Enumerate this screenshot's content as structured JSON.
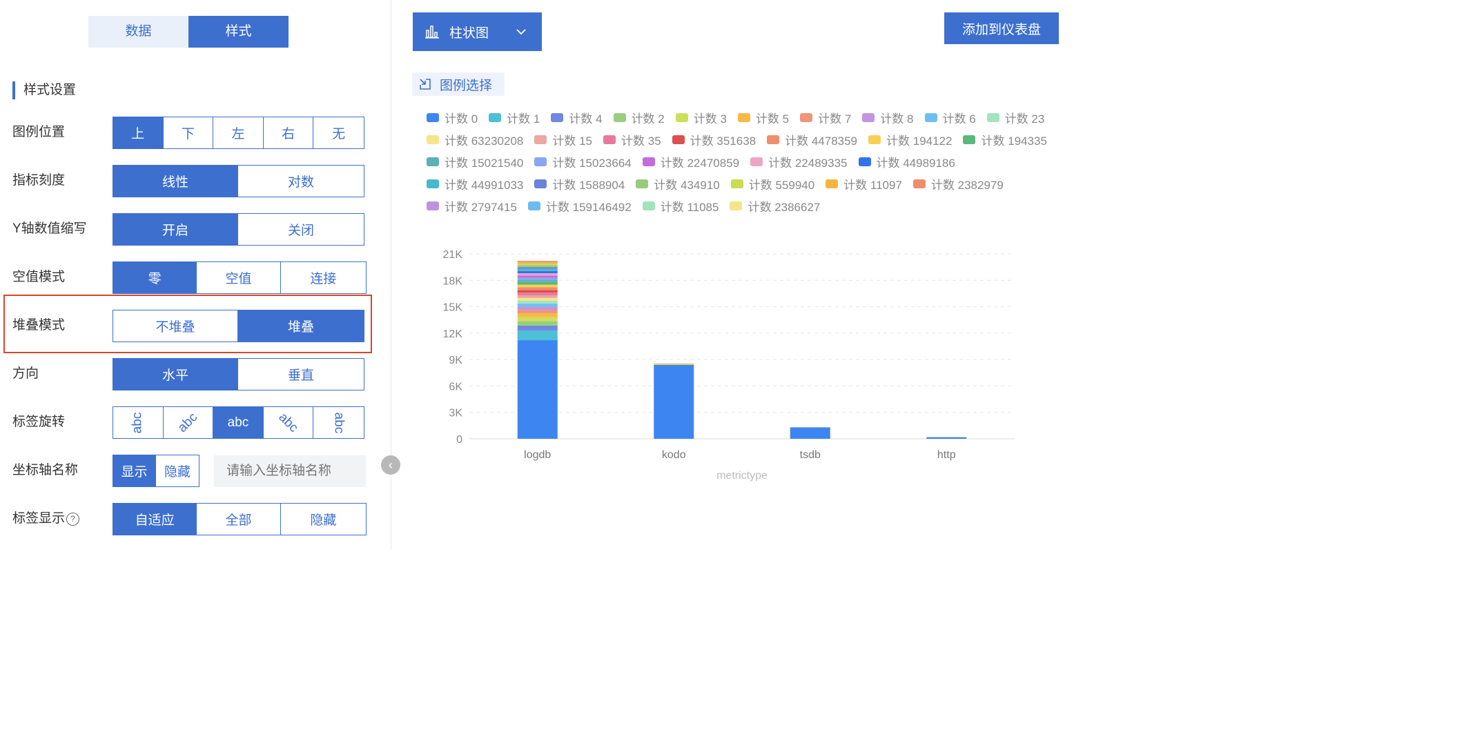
{
  "top_tabs": [
    {
      "label": "数据",
      "active": false
    },
    {
      "label": "样式",
      "active": true
    }
  ],
  "section_title": "样式设置",
  "settings": {
    "legend_position": {
      "label": "图例位置",
      "options": [
        "上",
        "下",
        "左",
        "右",
        "无"
      ],
      "selected": "上"
    },
    "scale": {
      "label": "指标刻度",
      "options": [
        "线性",
        "对数"
      ],
      "selected": "线性"
    },
    "y_abbrev": {
      "label": "Y轴数值缩写",
      "options": [
        "开启",
        "关闭"
      ],
      "selected": "开启"
    },
    "null_mode": {
      "label": "空值模式",
      "options": [
        "零",
        "空值",
        "连接"
      ],
      "selected": "零"
    },
    "stack_mode": {
      "label": "堆叠模式",
      "options": [
        "不堆叠",
        "堆叠"
      ],
      "selected": "堆叠"
    },
    "direction": {
      "label": "方向",
      "options": [
        "水平",
        "垂直"
      ],
      "selected": "水平"
    },
    "label_rotation": {
      "label": "标签旋转",
      "options": [
        "abc",
        "abc",
        "abc",
        "abc",
        "abc"
      ],
      "selected_index": 2
    },
    "axis_name": {
      "label": "坐标轴名称",
      "options": [
        "显示",
        "隐藏"
      ],
      "selected": "显示",
      "placeholder": "请输入坐标轴名称"
    },
    "label_display": {
      "label": "标签显示",
      "options": [
        "自适应",
        "全部",
        "隐藏"
      ],
      "selected": "自适应",
      "help_icon": "question-circle-icon"
    }
  },
  "chart_type_label": "柱状图",
  "chart_type_icon": "bar-chart-icon",
  "add_button_label": "添加到仪表盘",
  "legend_select_label": "图例选择",
  "legend_items": [
    {
      "label": "计数 0",
      "color": "#3d85f0"
    },
    {
      "label": "计数 1",
      "color": "#4dbfd6"
    },
    {
      "label": "计数 4",
      "color": "#7088e0"
    },
    {
      "label": "计数 2",
      "color": "#98cf7e"
    },
    {
      "label": "计数 3",
      "color": "#cde05a"
    },
    {
      "label": "计数 5",
      "color": "#f6b948"
    },
    {
      "label": "计数 7",
      "color": "#f0957a"
    },
    {
      "label": "计数 8",
      "color": "#c096de"
    },
    {
      "label": "计数 6",
      "color": "#6fbef2"
    },
    {
      "label": "计数 23",
      "color": "#a4e3bf"
    },
    {
      "label": "计数 63230208",
      "color": "#f6e48a"
    },
    {
      "label": "计数 15",
      "color": "#eaa8a0"
    },
    {
      "label": "计数 35",
      "color": "#e8799e"
    },
    {
      "label": "计数 351638",
      "color": "#dd5050"
    },
    {
      "label": "计数 4478359",
      "color": "#ef8e6c"
    },
    {
      "label": "计数 194122",
      "color": "#f8cf55"
    },
    {
      "label": "计数 194335",
      "color": "#5bb77c"
    },
    {
      "label": "计数 15021540",
      "color": "#5ab2b6"
    },
    {
      "label": "计数 15023664",
      "color": "#8aa5f2"
    },
    {
      "label": "计数 22470859",
      "color": "#c46be0"
    },
    {
      "label": "计数 22489335",
      "color": "#eea5c5"
    },
    {
      "label": "计数 44989186",
      "color": "#2f74ea"
    },
    {
      "label": "计数 44991033",
      "color": "#48b8cf"
    },
    {
      "label": "计数 1588904",
      "color": "#6b82d8"
    },
    {
      "label": "计数 434910",
      "color": "#98cc7a"
    },
    {
      "label": "计数 559940",
      "color": "#c9dc52"
    },
    {
      "label": "计数 11097",
      "color": "#f5b441"
    },
    {
      "label": "计数 2382979",
      "color": "#ee8d6e"
    },
    {
      "label": "计数 2797415",
      "color": "#bf92dd"
    },
    {
      "label": "计数 159146492",
      "color": "#6cbcf0"
    },
    {
      "label": "计数 11085",
      "color": "#a2e2bd"
    },
    {
      "label": "计数 2386627",
      "color": "#f6e488"
    }
  ],
  "chart_data": {
    "type": "bar",
    "stacked": true,
    "categories": [
      "logdb",
      "kodo",
      "tsdb",
      "http"
    ],
    "xlabel": "metrictype",
    "ylabel": "",
    "ylim": [
      0,
      21000
    ],
    "y_ticks": [
      "0",
      "3K",
      "6K",
      "9K",
      "12K",
      "15K",
      "18K",
      "21K"
    ],
    "grid": true,
    "series": [
      {
        "name": "计数 0",
        "values": [
          11200,
          8400,
          1300,
          180
        ]
      },
      {
        "name": "计数 1",
        "values": [
          1100,
          0,
          0,
          0
        ]
      },
      {
        "name": "计数 4",
        "values": [
          550,
          0,
          0,
          0
        ]
      },
      {
        "name": "计数 2",
        "values": [
          500,
          0,
          0,
          0
        ]
      },
      {
        "name": "计数 3",
        "values": [
          450,
          80,
          0,
          0
        ]
      },
      {
        "name": "计数 5",
        "values": [
          450,
          80,
          0,
          0
        ]
      },
      {
        "name": "计数 7",
        "values": [
          400,
          0,
          0,
          0
        ]
      },
      {
        "name": "计数 8",
        "values": [
          350,
          0,
          0,
          0
        ]
      },
      {
        "name": "计数 6",
        "values": [
          350,
          0,
          0,
          0
        ]
      },
      {
        "name": "计数 23",
        "values": [
          350,
          0,
          0,
          0
        ]
      },
      {
        "name": "计数 63230208",
        "values": [
          300,
          0,
          0,
          0
        ]
      },
      {
        "name": "计数 15",
        "values": [
          300,
          0,
          0,
          0
        ]
      },
      {
        "name": "计数 35",
        "values": [
          300,
          0,
          0,
          0
        ]
      },
      {
        "name": "计数 351638",
        "values": [
          300,
          0,
          0,
          0
        ]
      },
      {
        "name": "计数 4478359",
        "values": [
          300,
          0,
          0,
          0
        ]
      },
      {
        "name": "计数 194122",
        "values": [
          300,
          0,
          0,
          0
        ]
      },
      {
        "name": "计数 194335",
        "values": [
          300,
          0,
          0,
          0
        ]
      },
      {
        "name": "计数 15021540",
        "values": [
          250,
          0,
          0,
          0
        ]
      },
      {
        "name": "计数 15023664",
        "values": [
          250,
          0,
          0,
          0
        ]
      },
      {
        "name": "计数 22470859",
        "values": [
          250,
          0,
          0,
          0
        ]
      },
      {
        "name": "计数 22489335",
        "values": [
          250,
          0,
          0,
          0
        ]
      },
      {
        "name": "计数 44989186",
        "values": [
          250,
          0,
          0,
          0
        ]
      },
      {
        "name": "计数 44991033",
        "values": [
          250,
          0,
          0,
          0
        ]
      },
      {
        "name": "计数 1588904",
        "values": [
          200,
          0,
          0,
          0
        ]
      },
      {
        "name": "计数 434910",
        "values": [
          200,
          0,
          0,
          0
        ]
      },
      {
        "name": "计数 559940",
        "values": [
          200,
          0,
          0,
          0
        ]
      },
      {
        "name": "计数 11097",
        "values": [
          150,
          0,
          0,
          0
        ]
      },
      {
        "name": "计数 2382979",
        "values": [
          150,
          0,
          0,
          0
        ]
      }
    ]
  }
}
